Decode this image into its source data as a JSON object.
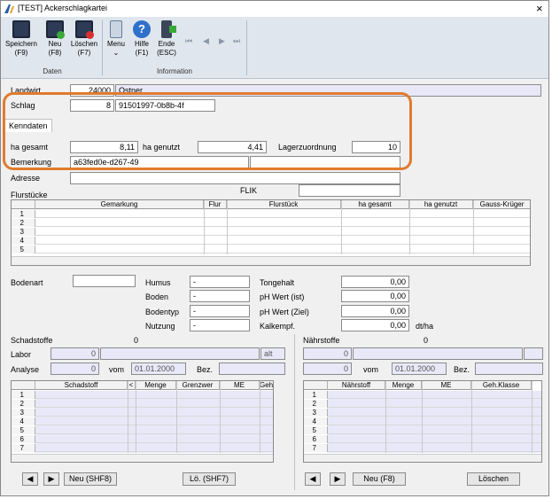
{
  "window": {
    "title": "[TEST] Ackerschlagkartei",
    "close_glyph": "×"
  },
  "ribbon": {
    "speichern": [
      "Speichern",
      "(F9)"
    ],
    "neu": [
      "Neu",
      "(F8)"
    ],
    "loeschen": [
      "Löschen",
      "(F7)"
    ],
    "menu": [
      "Menu",
      "⌄"
    ],
    "hilfe": [
      "Hilfe",
      "(F1)"
    ],
    "ende": [
      "Ende",
      "(ESC)"
    ],
    "group_daten": "Daten",
    "group_information": "Information",
    "nav": [
      "⏮",
      "◀",
      "▶",
      "⏭"
    ]
  },
  "header": {
    "landwirt_label": "Landwirt",
    "landwirt_nr": "24000",
    "landwirt_name": "Ostner",
    "schlag_label": "Schlag",
    "schlag_nr": "8",
    "schlag_id": "91501997-0b8b-4f"
  },
  "tab_kenndaten": "Kenndaten",
  "kenndaten": {
    "ha_gesamt_label": "ha gesamt",
    "ha_gesamt": "8,11",
    "ha_genutzt_label": "ha genutzt",
    "ha_genutzt": "4,41",
    "lagerzuordnung_label": "Lagerzuordnung",
    "lagerzuordnung": "10",
    "bemerkung_label": "Bemerkung",
    "bemerkung": "a63fed0e-d267-49",
    "adresse_label": "Adresse",
    "flurstuecke_label": "Flurstücke",
    "flik_label": "FLIK"
  },
  "flur_grid": {
    "headers": [
      "Gemarkung",
      "Flur",
      "Flurstück",
      "ha gesamt",
      "ha genutzt",
      "Gauss-Krüger"
    ],
    "rows": [
      "1",
      "2",
      "3",
      "4",
      "5"
    ]
  },
  "boden": {
    "bodenart_label": "Bodenart",
    "humus_label": "Humus",
    "humus": "-",
    "boden_label": "Boden",
    "boden": "-",
    "bodentyp_label": "Bodentyp",
    "bodentyp": "-",
    "nutzung_label": "Nutzung",
    "nutzung": "-",
    "tongehalt_label": "Tongehalt",
    "tongehalt": "0,00",
    "ph_ist_label": "pH Wert (ist)",
    "ph_ist": "0,00",
    "ph_ziel_label": "pH Wert (Ziel)",
    "ph_ziel": "0,00",
    "kalkempf_label": "Kalkempf.",
    "kalkempf": "0,00",
    "dtha": "dt/ha"
  },
  "schadstoffe": {
    "title": "Schadstoffe",
    "count": "0",
    "labor_label": "Labor",
    "labor": "0",
    "alt": "alt",
    "analyse_label": "Analyse",
    "analyse": "0",
    "vom_label": "vom",
    "vom": "01.01.2000",
    "bez_label": "Bez.",
    "headers": [
      "Schadstoff",
      "<",
      "Menge",
      "Grenzwer",
      "ME",
      "Geh."
    ],
    "rows": [
      "1",
      "2",
      "3",
      "4",
      "5",
      "6",
      "7"
    ],
    "btn_prev": "◀",
    "btn_next": "▶",
    "btn_neu": "Neu (SHF8)",
    "btn_loeschen": "Lö. (SHF7)"
  },
  "naehrstoffe": {
    "title": "Nährstoffe",
    "count": "0",
    "labor": "0",
    "analyse": "0",
    "vom_label": "vom",
    "vom": "01.01.2000",
    "bez_label": "Bez.",
    "headers": [
      "Nährstoff",
      "Menge",
      "ME",
      "Geh.Klasse"
    ],
    "rows": [
      "1",
      "2",
      "3",
      "4",
      "5",
      "6",
      "7"
    ],
    "btn_prev": "◀",
    "btn_next": "▶",
    "btn_neu": "Neu (F8)",
    "btn_loeschen": "Löschen"
  },
  "colors": {
    "highlight": "#e07b2e",
    "accent": "#2b5ea8",
    "lavender": "#e8e8f8"
  }
}
